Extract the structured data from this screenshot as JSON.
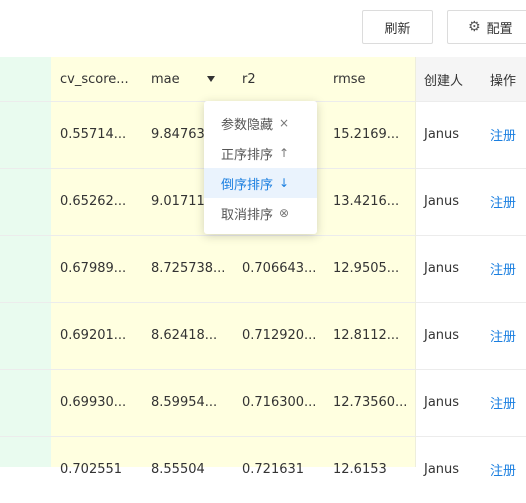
{
  "toolbar": {
    "refresh_label": "刷新",
    "config_label": "配置",
    "config_icon": "gear-icon"
  },
  "columns": [
    {
      "key": "cv_score",
      "label": "cv_score..."
    },
    {
      "key": "mae",
      "label": "mae",
      "sort_icon": "sort-triangle-down"
    },
    {
      "key": "r2",
      "label": "r2"
    },
    {
      "key": "rmse",
      "label": "rmse"
    },
    {
      "key": "creator",
      "label": "创建人"
    },
    {
      "key": "action",
      "label": "操作"
    }
  ],
  "rows": [
    {
      "cv_score": "0.55714...",
      "mae": "9.84763...",
      "r2": "",
      "rmse": "15.2169...",
      "creator": "Janus",
      "action": "注册"
    },
    {
      "cv_score": "0.65262...",
      "mae": "9.01711...",
      "r2": "",
      "rmse": "13.4216...",
      "creator": "Janus",
      "action": "注册"
    },
    {
      "cv_score": "0.67989...",
      "mae": "8.725738...",
      "r2": "0.706643...",
      "rmse": "12.9505...",
      "creator": "Janus",
      "action": "注册"
    },
    {
      "cv_score": "0.69201...",
      "mae": "8.62418...",
      "r2": "0.712920...",
      "rmse": "12.8112...",
      "creator": "Janus",
      "action": "注册"
    },
    {
      "cv_score": "0.69930...",
      "mae": "8.59954...",
      "r2": "0.716300...",
      "rmse": "12.73560...",
      "creator": "Janus",
      "action": "注册"
    },
    {
      "cv_score": "0.702551",
      "mae": "8.55504",
      "r2": "0.721631",
      "rmse": "12.6153",
      "creator": "Janus",
      "action": "注册"
    }
  ],
  "column_menu": {
    "items": [
      {
        "label": "参数隐藏",
        "icon": "×"
      },
      {
        "label": "正序排序",
        "icon": "↑"
      },
      {
        "label": "倒序排序",
        "icon": "↓"
      },
      {
        "label": "取消排序",
        "icon": "⊗"
      }
    ],
    "active_index": 2
  },
  "colors": {
    "link": "#1b7fe0",
    "param_column_bg": "#ffffe0",
    "lead_column_bg": "#e9fbef",
    "menu_active_bg": "#eaf3fd"
  }
}
